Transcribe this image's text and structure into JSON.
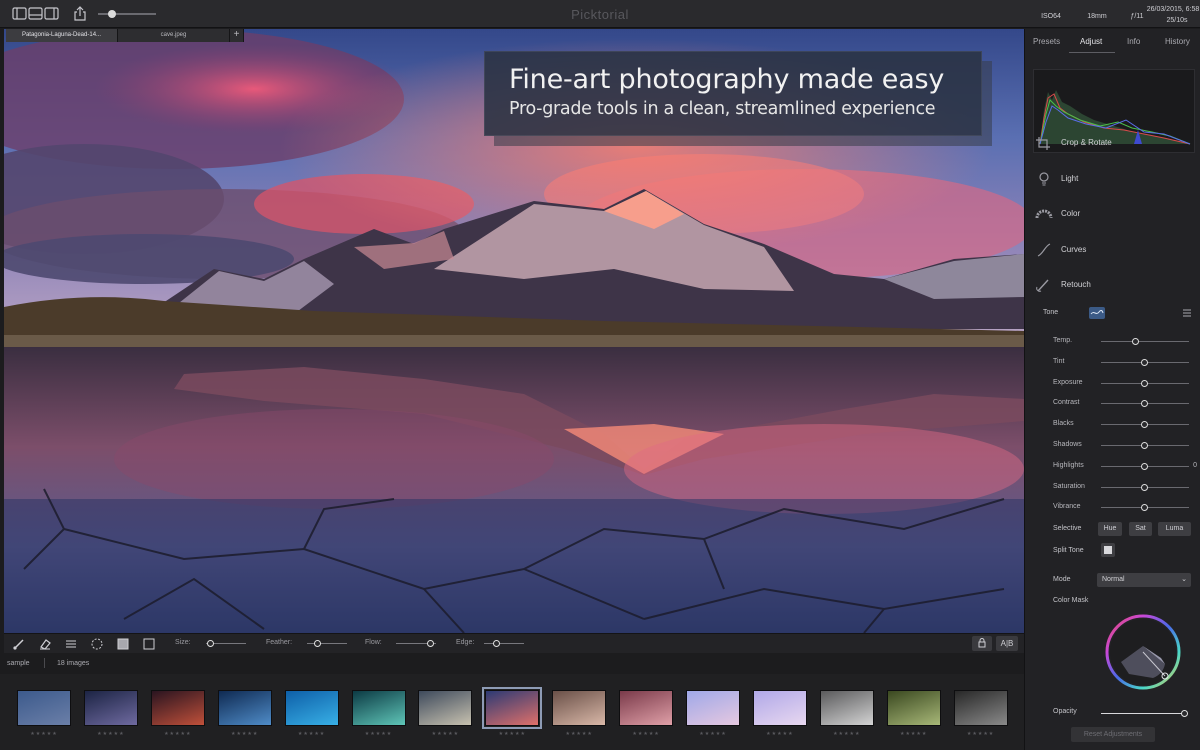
{
  "app": {
    "title": "Picktorial"
  },
  "titlebar": {
    "exif": [
      {
        "value": "ISO64",
        "label": ""
      },
      {
        "value": "18mm",
        "label": ""
      },
      {
        "value": "ƒ/11",
        "label": ""
      },
      {
        "value": "26/03/2015, 6:58",
        "label": "25/10s"
      }
    ]
  },
  "tabs": [
    {
      "label": "Patagonia-Laguna-Dead-14...",
      "active": true
    },
    {
      "label": "cave.jpeg",
      "active": false
    },
    {
      "label": "+",
      "active": false
    }
  ],
  "hero": {
    "headline": "Fine-art photography made easy",
    "subheadline": "Pro-grade tools in a clean, streamlined experience"
  },
  "brush_toolbar": {
    "size_label": "Size:",
    "feather_label": "Feather:",
    "flow_label": "Flow:",
    "edge_label": "Edge:",
    "compare_label": "A|B",
    "size_value": 0.1,
    "feather_value": 0.25,
    "flow_value": 0.85,
    "edge_value": 0.3
  },
  "filmstrip": {
    "album": "sample",
    "count": "18 images",
    "selected_index": 7,
    "stars": "★★★★★",
    "thumbs": [
      {
        "c1": "#3c5a8c",
        "c2": "#6b7fa8"
      },
      {
        "c1": "#1c2444",
        "c2": "#6f6aa0"
      },
      {
        "c1": "#2a1420",
        "c2": "#c0503a"
      },
      {
        "c1": "#0f2a52",
        "c2": "#4f8cc8"
      },
      {
        "c1": "#0e5fa8",
        "c2": "#38b0e6"
      },
      {
        "c1": "#0c3a44",
        "c2": "#5fc6b8"
      },
      {
        "c1": "#3e4a5c",
        "c2": "#c8c2b0"
      },
      {
        "c1": "#2c3a74",
        "c2": "#e0706a"
      },
      {
        "c1": "#6a5048",
        "c2": "#d9b8a8"
      },
      {
        "c1": "#7a3a4a",
        "c2": "#e0a0a8"
      },
      {
        "c1": "#9fa8e8",
        "c2": "#e6c8e0"
      },
      {
        "c1": "#b0a8e8",
        "c2": "#e8d8f0"
      },
      {
        "c1": "#5a5a5c",
        "c2": "#d4d4d4"
      },
      {
        "c1": "#3a4820",
        "c2": "#a8b878"
      },
      {
        "c1": "#282828",
        "c2": "#8a8a8a"
      }
    ]
  },
  "panel": {
    "tabs": [
      "Presets",
      "Adjust",
      "Info",
      "History"
    ],
    "active_tab": "Adjust",
    "tools": [
      "Crop & Rotate",
      "Light",
      "Color",
      "Curves",
      "Retouch"
    ],
    "tone_label": "Tone",
    "adjustments": [
      {
        "label": "Temp.",
        "value": 0.4
      },
      {
        "label": "Tint",
        "value": 0.5
      },
      {
        "label": "Exposure",
        "value": 0.5
      },
      {
        "label": "Contrast",
        "value": 0.5
      },
      {
        "label": "Blacks",
        "value": 0.5
      },
      {
        "label": "Shadows",
        "value": 0.5
      },
      {
        "label": "Highlights",
        "value": 0.5,
        "display": "0"
      },
      {
        "label": "Saturation",
        "value": 0.5
      },
      {
        "label": "Vibrance",
        "value": 0.5
      }
    ],
    "selective_label": "Selective",
    "selective_buttons": [
      "Hue",
      "Sat",
      "Luma"
    ],
    "split_tone_label": "Split Tone",
    "mode_label": "Mode",
    "mode_value": "Normal",
    "color_mask_label": "Color Mask",
    "opacity_label": "Opacity",
    "opacity_value": 1.0,
    "reset_label": "Reset Adjustments"
  }
}
